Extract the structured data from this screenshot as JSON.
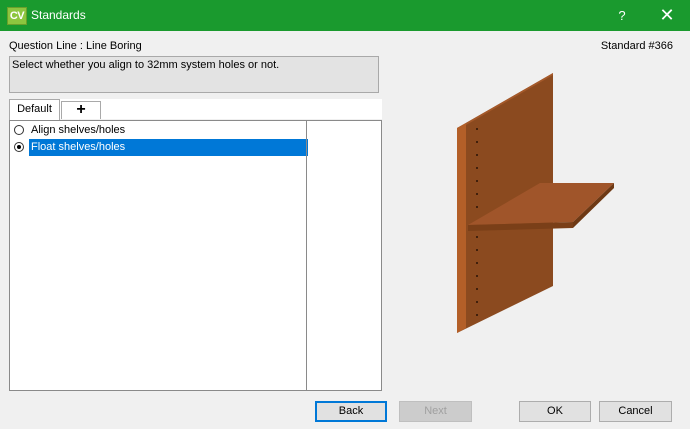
{
  "window": {
    "icon_text": "CV",
    "title": "Standards",
    "help_label": "?",
    "close_label": "✕"
  },
  "header": {
    "question_line": "Question Line : Line Boring",
    "standard_number": "Standard #366"
  },
  "description": "Select whether you align  to 32mm system holes or not.",
  "tabs": [
    {
      "label": "Default"
    },
    {
      "label": "+"
    }
  ],
  "options": [
    {
      "label": "Align shelves/holes",
      "selected": false
    },
    {
      "label": "Float shelves/holes",
      "selected": true
    }
  ],
  "buttons": {
    "back": "Back",
    "next": "Next",
    "ok": "OK",
    "cancel": "Cancel"
  },
  "colors": {
    "titlebar": "#1a9a2e",
    "app_icon": "#8dc63f",
    "selection": "#0078d7",
    "wood": "#8b4a1f"
  }
}
